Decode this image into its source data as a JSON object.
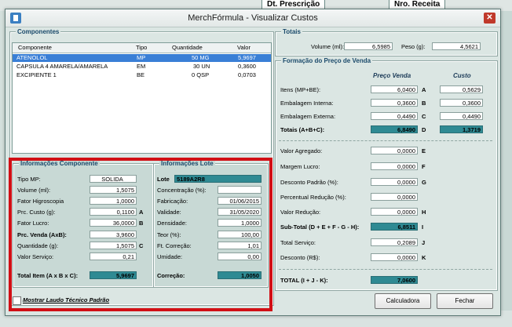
{
  "background": {
    "tab1": "Dt. Prescrição",
    "tab2": "Nro. Receita"
  },
  "window": {
    "title": "MerchFórmula - Visualizar Custos"
  },
  "componentes": {
    "title": "Componentes",
    "columns": [
      "Componente",
      "Tipo",
      "Quantidade",
      "Valor"
    ],
    "rows": [
      {
        "name": "ATENOLOL",
        "tipo": "MP",
        "qtd": "50 MG",
        "valor": "5,9697"
      },
      {
        "name": "CAPSULA 4 AMARELA/AMARELA",
        "tipo": "EM",
        "qtd": "30 UN",
        "valor": "0,3600"
      },
      {
        "name": "EXCIPIENTE 1",
        "tipo": "BE",
        "qtd": "0 QSP",
        "valor": "0,0703"
      }
    ]
  },
  "info_comp": {
    "title": "Informações Componente",
    "tipo_label": "Tipo MP:",
    "tipo": "SOLIDA",
    "volume_label": "Volume (ml):",
    "volume": "1,5075",
    "fator_label": "Fator Higroscopia",
    "fator": "1,0000",
    "custo_label": "Prc. Custo (g):",
    "custo": "0,1100",
    "custo_letter": "A",
    "lucro_label": "Fator Lucro:",
    "lucro": "36,0000",
    "lucro_letter": "B",
    "venda_label": "Prc. Venda (AxB):",
    "venda": "3,9600",
    "qtd_label": "Quantidade (g):",
    "qtd": "1,5075",
    "qtd_letter": "C",
    "servico_label": "Valor Serviço:",
    "servico": "0,21",
    "total_label": "Total Item (A x B x C):",
    "total": "5,9697"
  },
  "info_lote": {
    "title": "Informações Lote",
    "lote_label": "Lote",
    "lote": "5189A2R8",
    "conc_label": "Concentração (%):",
    "conc": "",
    "fab_label": "Fabricação:",
    "fab": "01/06/2015",
    "val_label": "Validade:",
    "val": "31/05/2020",
    "dens_label": "Densidade:",
    "dens": "1,0000",
    "teor_label": "Teor (%):",
    "teor": "100,00",
    "ft_label": "Ft. Correção:",
    "ft": "1,01",
    "umid_label": "Umidade:",
    "umid": "0,00",
    "corr_label": "Correção:",
    "corr": "1,0050"
  },
  "totais": {
    "title": "Totais",
    "volume_label": "Volume (ml):",
    "volume": "6,5985",
    "peso_label": "Peso (g):",
    "peso": "4,5621"
  },
  "formacao": {
    "title": "Formação do Preço de Venda",
    "col_venda": "Preço Venda",
    "col_custo": "Custo",
    "itens_label": "Itens (MP+BE):",
    "itens_venda": "6,0400",
    "itens_letter": "A",
    "itens_custo": "0,5629",
    "emb_int_label": "Embalagem Interna:",
    "emb_int_venda": "0,3600",
    "emb_int_letter": "B",
    "emb_int_custo": "0,3600",
    "emb_ext_label": "Embalagem Externa:",
    "emb_ext_venda": "0,4490",
    "emb_ext_letter": "C",
    "emb_ext_custo": "0,4490",
    "totais_label": "Totais (A+B+C):",
    "totais_venda": "6,8490",
    "totais_letter": "D",
    "totais_custo": "1,3719",
    "agregado_label": "Valor Agregado:",
    "agregado": "0,0000",
    "agregado_letter": "E",
    "margem_label": "Margem Lucro:",
    "margem": "0,0000",
    "margem_letter": "F",
    "desconto_label": "Desconto Padrão (%):",
    "desconto": "0,0000",
    "desconto_letter": "G",
    "perc_label": "Percentual Redução (%):",
    "perc": "0,0000",
    "reducao_label": "Valor Redução:",
    "reducao": "0,0000",
    "reducao_letter": "H",
    "subtotal_label": "Sub-Total (D + E + F - G - H):",
    "subtotal": "6,8511",
    "subtotal_letter": "I",
    "servico_label": "Total Serviço:",
    "servico": "0,2089",
    "servico_letter": "J",
    "descrs_label": "Desconto (R$):",
    "descrs": "0,0000",
    "descrs_letter": "K",
    "total_label": "TOTAL (I + J - K):",
    "total": "7,0600"
  },
  "footer": {
    "checkbox_label": "Mostrar Laudo Técnico Padrão",
    "calc_button": "Calculadora",
    "fechar_button": "Fechar"
  }
}
